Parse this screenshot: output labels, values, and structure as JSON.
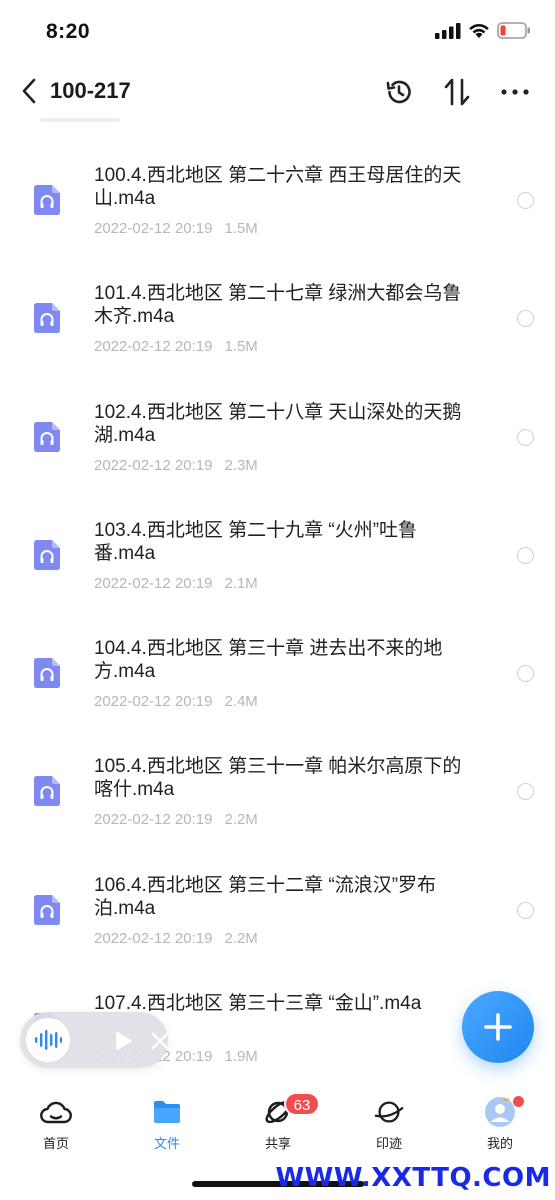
{
  "status_bar": {
    "time": "8:20"
  },
  "nav": {
    "title": "100-217",
    "actions": [
      "history-icon",
      "sort-icon",
      "more-icon"
    ]
  },
  "files": [
    {
      "name": "100.4.西北地区 第二十六章 西王母居住的天山.m4a",
      "date": "2022-02-12 20:19",
      "size": "1.5M"
    },
    {
      "name": "101.4.西北地区 第二十七章 绿洲大都会乌鲁木齐.m4a",
      "date": "2022-02-12 20:19",
      "size": "1.5M"
    },
    {
      "name": "102.4.西北地区 第二十八章 天山深处的天鹅湖.m4a",
      "date": "2022-02-12 20:19",
      "size": "2.3M"
    },
    {
      "name": "103.4.西北地区 第二十九章 “火州”吐鲁番.m4a",
      "date": "2022-02-12 20:19",
      "size": "2.1M"
    },
    {
      "name": "104.4.西北地区 第三十章 进去出不来的地方.m4a",
      "date": "2022-02-12 20:19",
      "size": "2.4M"
    },
    {
      "name": "105.4.西北地区 第三十一章 帕米尔高原下的喀什.m4a",
      "date": "2022-02-12 20:19",
      "size": "2.2M"
    },
    {
      "name": "106.4.西北地区 第三十二章 “流浪汉”罗布泊.m4a",
      "date": "2022-02-12 20:19",
      "size": "2.2M"
    },
    {
      "name": "107.4.西北地区 第三十三章 “金山”.m4a",
      "date": "2022-02-12 20:19",
      "size": "1.9M"
    }
  ],
  "tabs": [
    {
      "label": "首页",
      "icon": "home-cloud-icon"
    },
    {
      "label": "文件",
      "icon": "folder-icon"
    },
    {
      "label": "共享",
      "icon": "share-orbit-icon"
    },
    {
      "label": "印迹",
      "icon": "planet-icon"
    },
    {
      "label": "我的",
      "icon": "avatar-icon"
    }
  ],
  "share_badge": "63",
  "watermark": "WWW.XXTTQ.COM",
  "colors": {
    "accent": "#2a8cf5",
    "file_icon": "#7f86f0",
    "badge": "#f04e4e",
    "meta_text": "#b4b7c0"
  }
}
